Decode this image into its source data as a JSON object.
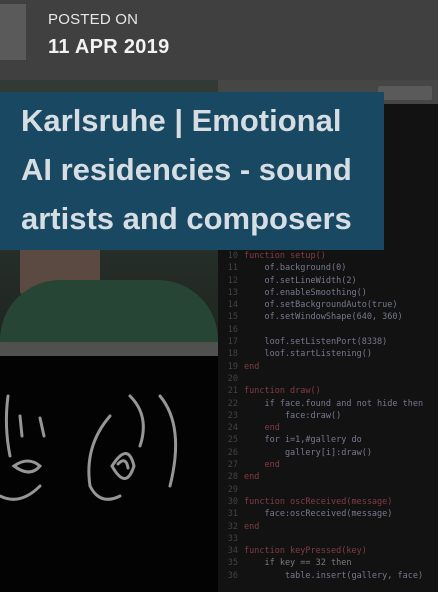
{
  "post": {
    "posted_label": "POSTED ON",
    "date": "11 APR 2019",
    "title": "Karlsruhe | Emotional AI residencies - sound artists and composers"
  },
  "image": {
    "description_icon": "image-thumbnail",
    "code_lines": [
      {
        "n": "10",
        "text": "function setup()"
      },
      {
        "n": "11",
        "text": "    of.background(0)"
      },
      {
        "n": "12",
        "text": "    of.setLineWidth(2)"
      },
      {
        "n": "13",
        "text": "    of.enableSmoothing()"
      },
      {
        "n": "14",
        "text": "    of.setBackgroundAuto(true)"
      },
      {
        "n": "15",
        "text": "    of.setWindowShape(640, 360)"
      },
      {
        "n": "16",
        "text": ""
      },
      {
        "n": "17",
        "text": "    loof.setListenPort(8338)"
      },
      {
        "n": "18",
        "text": "    loof.startListening()"
      },
      {
        "n": "19",
        "text": "end"
      },
      {
        "n": "20",
        "text": ""
      },
      {
        "n": "21",
        "text": "function draw()"
      },
      {
        "n": "22",
        "text": "    if face.found and not hide then"
      },
      {
        "n": "23",
        "text": "        face:draw()"
      },
      {
        "n": "24",
        "text": "    end"
      },
      {
        "n": "25",
        "text": "    for i=1,#gallery do"
      },
      {
        "n": "26",
        "text": "        gallery[i]:draw()"
      },
      {
        "n": "27",
        "text": "    end"
      },
      {
        "n": "28",
        "text": "end"
      },
      {
        "n": "29",
        "text": ""
      },
      {
        "n": "30",
        "text": "function oscReceived(message)"
      },
      {
        "n": "31",
        "text": "    face:oscReceived(message)"
      },
      {
        "n": "32",
        "text": "end"
      },
      {
        "n": "33",
        "text": ""
      },
      {
        "n": "34",
        "text": "function keyPressed(key)"
      },
      {
        "n": "35",
        "text": "    if key == 32 then"
      },
      {
        "n": "36",
        "text": "        table.insert(gallery, face)"
      }
    ]
  },
  "colors": {
    "title_bg": "#184862",
    "title_text": "#d6dee4",
    "header_bg": "#404040"
  }
}
